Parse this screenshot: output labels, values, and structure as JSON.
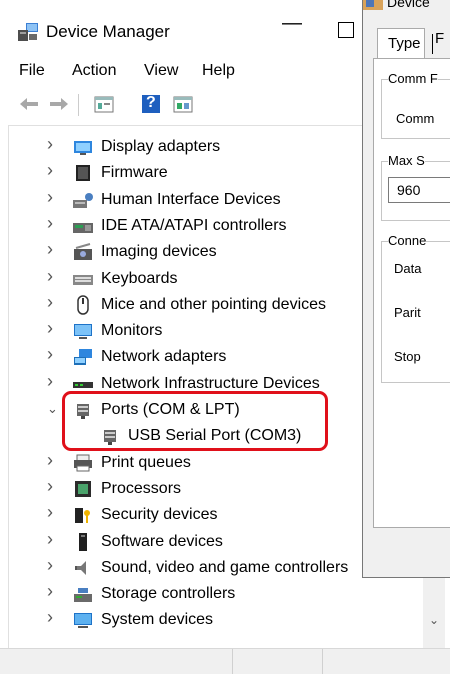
{
  "window": {
    "title": "Device Manager",
    "minimize_glyph": "—",
    "menu": [
      "File",
      "Action",
      "View",
      "Help"
    ]
  },
  "toolbar": {
    "icons": [
      "back-arrow-icon",
      "forward-arrow-icon",
      "properties-icon",
      "help-icon",
      "view-icon"
    ],
    "help_glyph": "?"
  },
  "tree": {
    "items": [
      {
        "label": "Display adapters",
        "icon": "display-adapter-icon",
        "expanded": false
      },
      {
        "label": "Firmware",
        "icon": "firmware-icon",
        "expanded": false
      },
      {
        "label": "Human Interface Devices",
        "icon": "hid-icon",
        "expanded": false
      },
      {
        "label": "IDE ATA/ATAPI controllers",
        "icon": "ide-controller-icon",
        "expanded": false
      },
      {
        "label": "Imaging devices",
        "icon": "camera-icon",
        "expanded": false
      },
      {
        "label": "Keyboards",
        "icon": "keyboard-icon",
        "expanded": false
      },
      {
        "label": "Mice and other pointing devices",
        "icon": "mouse-icon",
        "expanded": false
      },
      {
        "label": "Monitors",
        "icon": "monitor-icon",
        "expanded": false
      },
      {
        "label": "Network adapters",
        "icon": "network-adapter-icon",
        "expanded": false
      },
      {
        "label": "Network Infrastructure Devices",
        "icon": "network-infrastructure-icon",
        "expanded": false
      },
      {
        "label": "Ports (COM & LPT)",
        "icon": "port-icon",
        "expanded": true
      },
      {
        "label": "USB Serial Port (COM3)",
        "icon": "port-icon",
        "child": true
      },
      {
        "label": "Print queues",
        "icon": "printer-icon",
        "expanded": false
      },
      {
        "label": "Processors",
        "icon": "processor-icon",
        "expanded": false
      },
      {
        "label": "Security devices",
        "icon": "security-icon",
        "expanded": false
      },
      {
        "label": "Software devices",
        "icon": "software-device-icon",
        "expanded": false
      },
      {
        "label": "Sound, video and game controllers",
        "icon": "speaker-icon",
        "expanded": false
      },
      {
        "label": "Storage controllers",
        "icon": "storage-icon",
        "expanded": false
      },
      {
        "label": "System devices",
        "icon": "system-device-icon",
        "expanded": false
      }
    ],
    "collapsed_chevron": "›",
    "expanded_chevron": "⌄"
  },
  "dialog": {
    "title": "Device",
    "tabs": [
      "Type",
      "F"
    ],
    "texts": {
      "group1": "Comm F",
      "line1": "Comm",
      "group2": "Max S",
      "baud": "960",
      "group3": "Conne",
      "data": "Data",
      "parity": "Parit",
      "stop": "Stop"
    }
  },
  "scrollbar": {
    "down_glyph": "⌄"
  },
  "colors": {
    "highlight": "#e0101a"
  }
}
